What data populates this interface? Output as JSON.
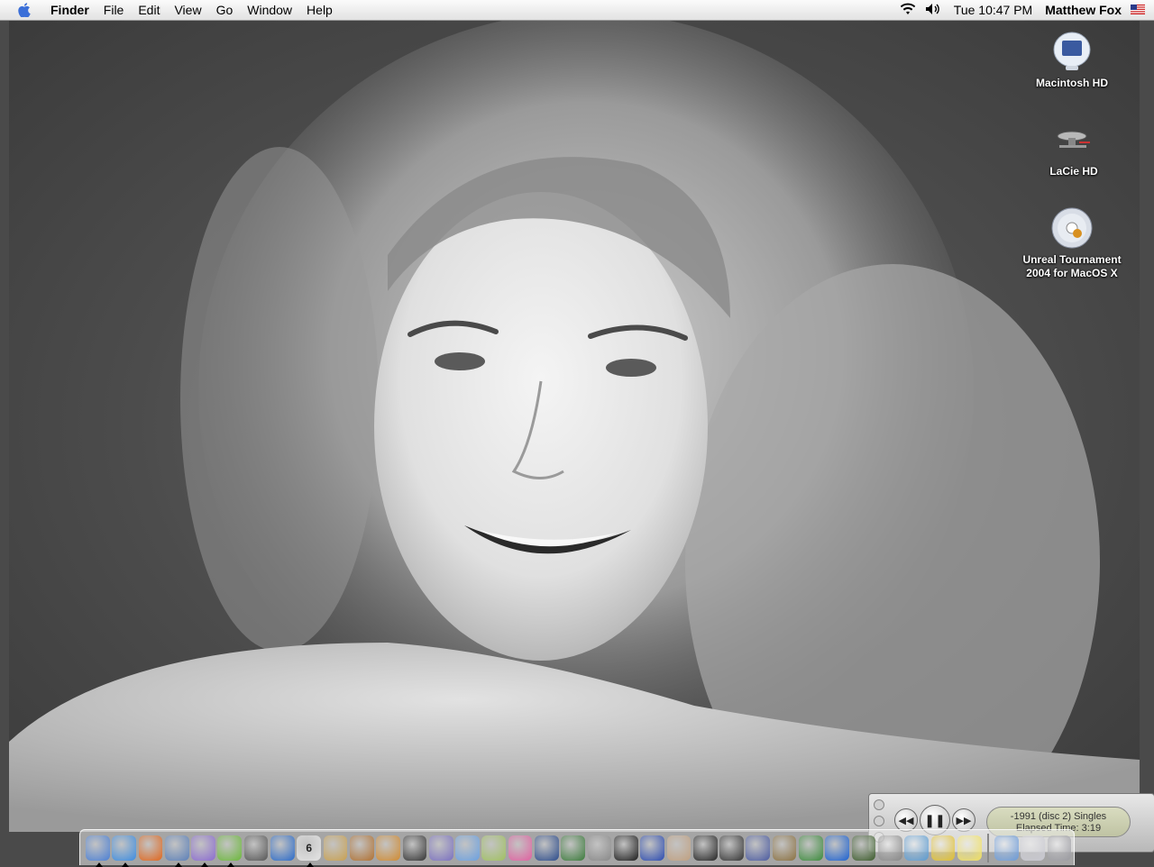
{
  "menubar": {
    "app_name": "Finder",
    "items": [
      "File",
      "Edit",
      "View",
      "Go",
      "Window",
      "Help"
    ],
    "clock": "Tue 10:47 PM",
    "user": "Matthew Fox"
  },
  "desktop_icons": [
    {
      "label": "Macintosh HD",
      "icon": "imac-hard-drive-icon"
    },
    {
      "label": "LaCie HD",
      "icon": "starship-drive-icon"
    },
    {
      "label": "Unreal Tournament 2004 for MacOS X",
      "icon": "cd-disc-icon"
    }
  ],
  "controller": {
    "track": "-1991 (disc 2)  Singles",
    "elapsed": "Elapsed Time: 3:19"
  },
  "dock": {
    "items": [
      {
        "name": "finder",
        "color": "#4a7fd4"
      },
      {
        "name": "safari",
        "color": "#3a8be0"
      },
      {
        "name": "firefox",
        "color": "#e0661c"
      },
      {
        "name": "mail",
        "color": "#5a7fb8"
      },
      {
        "name": "ichat",
        "color": "#8a6ad0"
      },
      {
        "name": "itunes",
        "color": "#6bb83a"
      },
      {
        "name": "spy-hat",
        "color": "#555555"
      },
      {
        "name": "word",
        "color": "#2a6ac8"
      },
      {
        "name": "ical",
        "color": "#e4e4e4",
        "text": "6"
      },
      {
        "name": "hammer-tool",
        "color": "#c8a050"
      },
      {
        "name": "iphoto",
        "color": "#b07030"
      },
      {
        "name": "garageband",
        "color": "#d08a30"
      },
      {
        "name": "imovie",
        "color": "#333333"
      },
      {
        "name": "dvd-player",
        "color": "#7a70c0"
      },
      {
        "name": "address-book",
        "color": "#6aa0e0"
      },
      {
        "name": "pen-tool",
        "color": "#a0c060"
      },
      {
        "name": "flower-app",
        "color": "#e060a0"
      },
      {
        "name": "textedit",
        "color": "#2a4a8a"
      },
      {
        "name": "money-app",
        "color": "#3a7a3a"
      },
      {
        "name": "x-game",
        "color": "#888888"
      },
      {
        "name": "shield-game",
        "color": "#1a1a1a"
      },
      {
        "name": "unreal",
        "color": "#2a4ab0"
      },
      {
        "name": "creature-game",
        "color": "#c0a080"
      },
      {
        "name": "vader-game",
        "color": "#222222"
      },
      {
        "name": "tie-fighter",
        "color": "#333333"
      },
      {
        "name": "starfighter",
        "color": "#4a5aa0"
      },
      {
        "name": "castle-game",
        "color": "#8a7040"
      },
      {
        "name": "palm-tree-game",
        "color": "#3a8a3a"
      },
      {
        "name": "blue-ring",
        "color": "#1a60d0"
      },
      {
        "name": "monster-game",
        "color": "#3a5a2a"
      },
      {
        "name": "sync-app",
        "color": "#888888"
      },
      {
        "name": "chat-bubble",
        "color": "#5a9ad0"
      },
      {
        "name": "runner-app",
        "color": "#e0c030"
      },
      {
        "name": "stickies",
        "color": "#f0e060"
      }
    ],
    "right_items": [
      {
        "name": "applications-folder",
        "color": "#6a9ad8"
      },
      {
        "name": "minimized-window",
        "color": "#c8c8d0"
      },
      {
        "name": "trash",
        "color": "#9a9aa0"
      }
    ]
  }
}
